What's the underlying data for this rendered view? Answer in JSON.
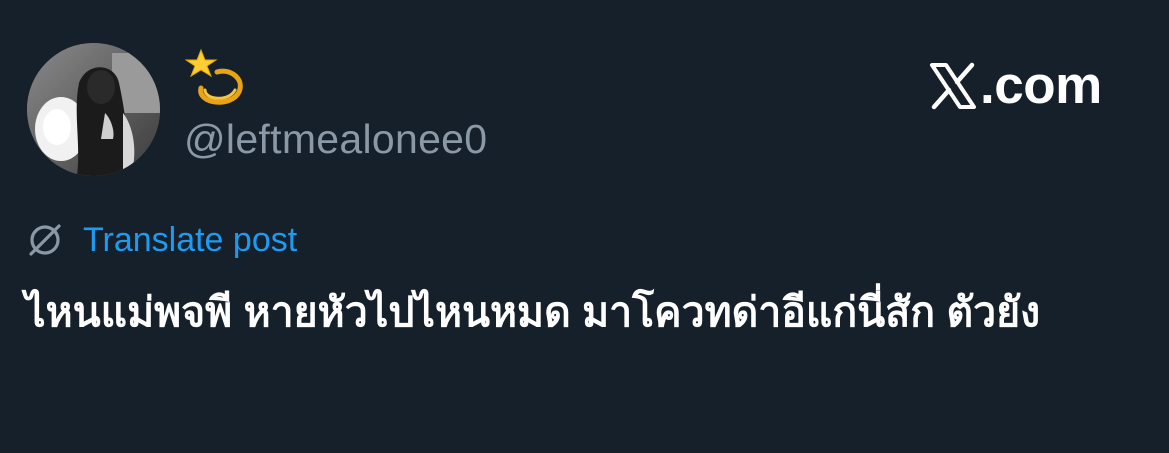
{
  "post": {
    "display_name_icon": "dizzy-emoji",
    "handle": "@leftmealonee0",
    "brand_text": ".com",
    "translate_label": "Translate post",
    "text": "ไหนแม่พจพี หายหัวไปไหนหมด มาโควทด่าอีแก่นี่สัก ตัวยัง"
  },
  "colors": {
    "background": "#16202b",
    "text": "#ffffff",
    "muted": "#8b98a5",
    "accent": "#1d9bf0"
  }
}
